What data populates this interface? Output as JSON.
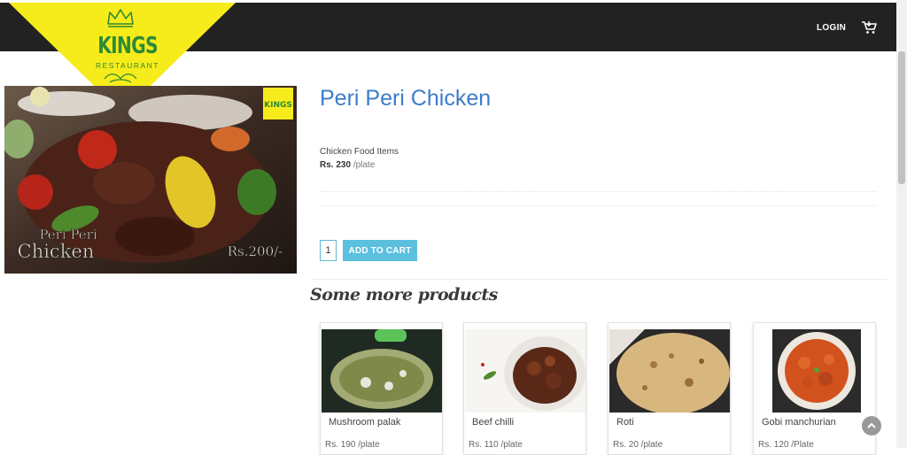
{
  "header": {
    "brand": "KINGS",
    "brand_sub": "RESTAURANT",
    "login_label": "LOGIN",
    "cart_icon": "cart-icon"
  },
  "hero_image": {
    "caption_line1": "Peri Peri",
    "caption_line2": "Chicken",
    "price_tag": "Rs.200/-",
    "badge": "KINGS"
  },
  "product": {
    "title": "Peri Peri Chicken",
    "category": "Chicken Food Items",
    "price": "Rs. 230",
    "unit": "/plate",
    "quantity": "1",
    "add_to_cart_label": "ADD TO CART"
  },
  "more": {
    "heading": "Some more products",
    "items": [
      {
        "name": "Mushroom palak",
        "price": "Rs. 190 /plate"
      },
      {
        "name": "Beef chilli",
        "price": "Rs. 110 /plate"
      },
      {
        "name": "Roti",
        "price": "Rs. 20 /plate"
      },
      {
        "name": "Gobi manchurian",
        "price": "Rs. 120 /Plate"
      }
    ]
  },
  "colors": {
    "topbar": "#222222",
    "logo_yellow": "#f7ec1b",
    "title_blue": "#3d7cc9",
    "button_blue": "#5bc0de"
  }
}
